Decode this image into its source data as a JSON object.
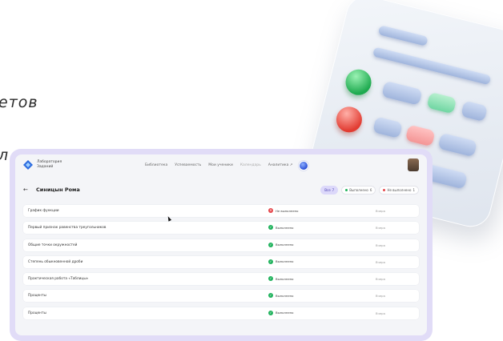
{
  "background": {
    "text_1": "етов",
    "text_2": "л"
  },
  "app": {
    "logo_line1": "Лаборатория",
    "logo_line2": "Заданий",
    "nav": [
      "Библиотека",
      "Успеваемость",
      "Мои ученики",
      "Календарь",
      "Аналитика ↗"
    ],
    "student_name": "Синицын Рома",
    "back_icon": "arrow-left-icon",
    "filters": [
      {
        "label": "Все",
        "count": "7",
        "active": true
      },
      {
        "label": "Выполнено",
        "count": "6",
        "color": "#22b35e"
      },
      {
        "label": "Не выполнено",
        "count": "1",
        "color": "#e5484d"
      }
    ],
    "rows": [
      {
        "name": "График функции",
        "status": "Не выполнено",
        "ok": false,
        "date": "Вчера"
      },
      {
        "name": "Первый признак равенства треугольников",
        "status": "Выполнено",
        "ok": true,
        "date": "Вчера"
      },
      {
        "name": "Общие точки окружностей",
        "status": "Выполнено",
        "ok": true,
        "date": "Вчера"
      },
      {
        "name": "Степень обыкновенной дроби",
        "status": "Выполнено",
        "ok": true,
        "date": "Вчера"
      },
      {
        "name": "Практическая работа «Таблицы»",
        "status": "Выполнено",
        "ok": true,
        "date": "Вчера"
      },
      {
        "name": "Проценты",
        "status": "Выполнено",
        "ok": true,
        "date": "Вчера"
      },
      {
        "name": "Проценты",
        "status": "Выполнено",
        "ok": true,
        "date": "Вчера"
      }
    ]
  }
}
